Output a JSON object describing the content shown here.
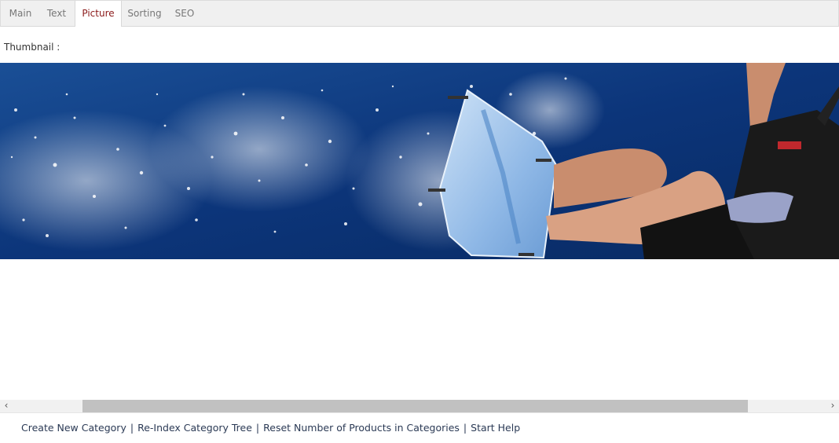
{
  "tabs": [
    {
      "label": "Main"
    },
    {
      "label": "Text"
    },
    {
      "label": "Picture"
    },
    {
      "label": "Sorting"
    },
    {
      "label": "SEO"
    }
  ],
  "active_tab": "Picture",
  "picture_section": {
    "label": "Thumbnail :"
  },
  "scrollbar": {
    "left_arrow": "‹",
    "right_arrow": "›"
  },
  "footer": {
    "links": [
      {
        "label": "Create New Category"
      },
      {
        "label": "Re-Index Category Tree"
      },
      {
        "label": "Reset Number of Products in Categories"
      },
      {
        "label": "Start Help"
      }
    ],
    "separator": "|"
  },
  "colors": {
    "active_tab_text": "#8b1a1a",
    "tab_text": "#777777",
    "link": "#2b3a55",
    "water": "#0f3b7d"
  }
}
